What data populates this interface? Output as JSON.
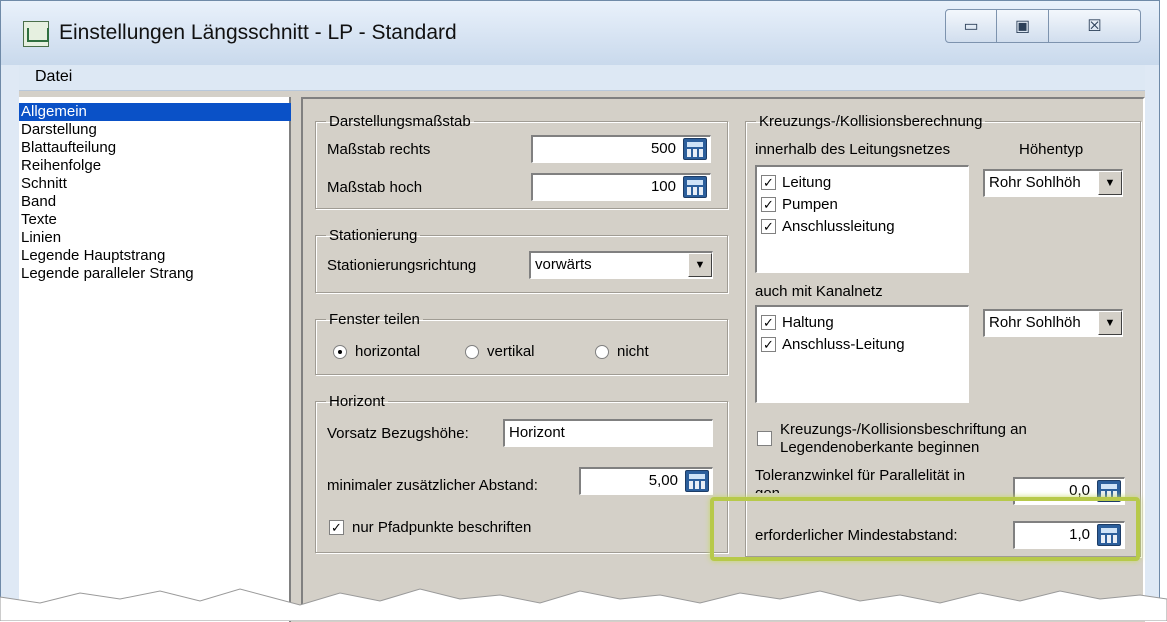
{
  "window": {
    "title": "Einstellungen Längsschnitt - LP - Standard",
    "controls": {
      "minimize": "▭",
      "maximize": "▣",
      "close": "☒"
    }
  },
  "menubar": {
    "items": [
      "Datei"
    ]
  },
  "sidebar": {
    "items": [
      {
        "label": "Allgemein",
        "selected": true
      },
      {
        "label": "Darstellung"
      },
      {
        "label": "Blattaufteilung"
      },
      {
        "label": "Reihenfolge"
      },
      {
        "label": "Schnitt"
      },
      {
        "label": "Band"
      },
      {
        "label": "Texte"
      },
      {
        "label": "Linien"
      },
      {
        "label": "Legende Hauptstrang"
      },
      {
        "label": "Legende paralleler Strang"
      }
    ]
  },
  "darstellung": {
    "legend": "Darstellungsmaßstab",
    "rechts_label": "Maßstab rechts",
    "rechts_value": "500",
    "hoch_label": "Maßstab hoch",
    "hoch_value": "100"
  },
  "stationierung": {
    "legend": "Stationierung",
    "label": "Stationierungsrichtung",
    "value": "vorwärts"
  },
  "fenster": {
    "legend": "Fenster teilen",
    "options": [
      {
        "label": "horizontal",
        "checked": true
      },
      {
        "label": "vertikal",
        "checked": false
      },
      {
        "label": "nicht",
        "checked": false
      }
    ]
  },
  "horizont": {
    "legend": "Horizont",
    "vorsatz_label": "Vorsatz Bezugshöhe:",
    "vorsatz_value": "Horizont",
    "abstand_label": "minimaler zusätzlicher Abstand:",
    "abstand_value": "5,00",
    "pfad_label": "nur Pfadpunkte beschriften",
    "pfad_checked": true
  },
  "kreuzung": {
    "legend": "Kreuzungs-/Kollisionsberechnung",
    "netz_label": "innerhalb des Leitungsnetzes",
    "hoehentyp_label": "Höhentyp",
    "netz_items": [
      {
        "label": "Leitung",
        "checked": true
      },
      {
        "label": "Pumpen",
        "checked": true
      },
      {
        "label": "Anschlussleitung",
        "checked": true
      }
    ],
    "hoehentyp_value": "Rohr Sohlhöh",
    "kanal_label": "auch mit Kanalnetz",
    "kanal_items": [
      {
        "label": "Haltung",
        "checked": true
      },
      {
        "label": "Anschluss-Leitung",
        "checked": true
      }
    ],
    "kanal_hoehentyp_value": "Rohr Sohlhöh",
    "beschriftung_line1": "Kreuzungs-/Kollisionsbeschriftung an",
    "beschriftung_line2": "Legendenoberkante beginnen",
    "beschriftung_checked": false,
    "toleranz_line1": "Toleranzwinkel für Parallelität in",
    "toleranz_line2": "gon",
    "toleranz_value": "0,0",
    "mindest_label": "erforderlicher Mindestabstand:",
    "mindest_value": "1,0"
  },
  "colors": {
    "selection": "#0a51c7",
    "highlight": "#b7c94a",
    "dialog_bg": "#d4d0c8"
  }
}
